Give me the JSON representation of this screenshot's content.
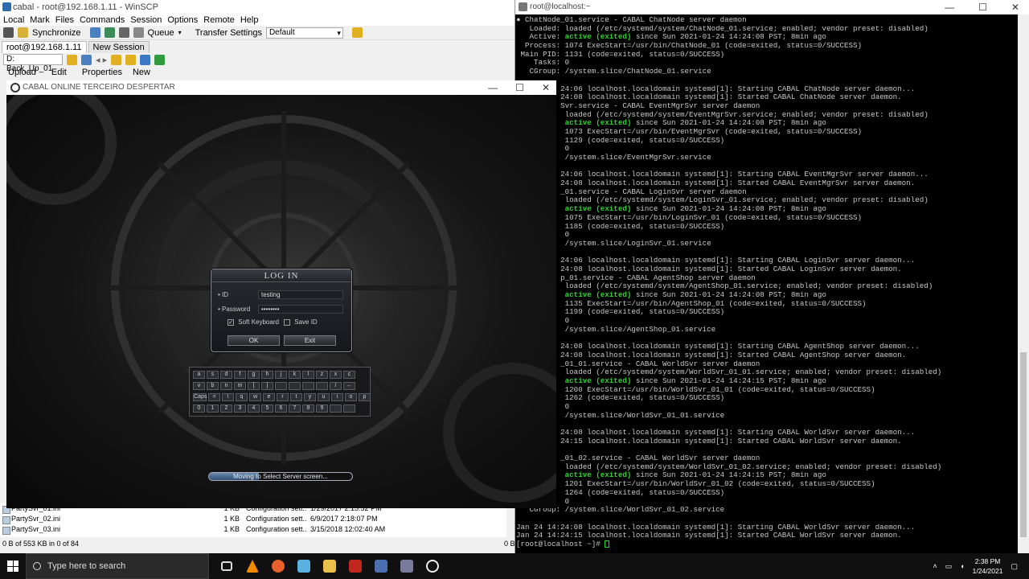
{
  "winscp": {
    "title": "cabal - root@192.168.1.11 - WinSCP",
    "menu": [
      "Local",
      "Mark",
      "Files",
      "Commands",
      "Session",
      "Options",
      "Remote",
      "Help"
    ],
    "toolbar": {
      "synchronize": "Synchronize",
      "queue": "Queue",
      "transfer_settings": "Transfer Settings",
      "transfer_value": "Default"
    },
    "tabs": [
      "root@192.168.1.11",
      "New Session"
    ],
    "drive": "D: Back_Up_01",
    "actions": {
      "upload": "Upload",
      "edit": "Edit",
      "properties": "Properties",
      "new": "New"
    },
    "files": [
      {
        "name": "PartySvr_01.ini",
        "size": "1 KB",
        "type": "Configuration sett...",
        "modified": "1/29/2017  2:15:52 PM"
      },
      {
        "name": "PartySvr_02.ini",
        "size": "1 KB",
        "type": "Configuration sett...",
        "modified": "6/9/2017  2:18:07 PM"
      },
      {
        "name": "PartySvr_03.ini",
        "size": "1 KB",
        "type": "Configuration sett...",
        "modified": "3/15/2018  12:02:40 AM"
      }
    ],
    "status": "0 B of 553 KB in 0 of 84",
    "status_right": "0 B"
  },
  "game": {
    "title": "CABAL ONLINE TERCEIRO DESPERTAR",
    "login": {
      "heading": "LOG IN",
      "id_label": "ID",
      "id_value": "testing",
      "password_label": "Password",
      "password_value": "••••••••",
      "soft_keyboard": "Soft Keyboard",
      "save_id": "Save ID",
      "ok": "OK",
      "exit": "Exit"
    },
    "keyboard_rows": [
      [
        "a",
        "s",
        "d",
        "f",
        "g",
        "h",
        "j",
        "k",
        "l",
        "z",
        "x",
        "c"
      ],
      [
        "v",
        "b",
        "n",
        "m",
        "[",
        "]",
        "",
        "",
        "",
        "",
        "/",
        "←"
      ],
      [
        "Caps",
        "=",
        "\\",
        "q",
        "w",
        "e",
        "r",
        "t",
        "y",
        "u",
        "i",
        "o",
        "p"
      ],
      [
        "0",
        "1",
        "2",
        "3",
        "4",
        "5",
        "6",
        "7",
        "8",
        "9",
        "",
        ""
      ]
    ],
    "progress_text": "Moving to Select Server screen...",
    "progress_fraction": 0.35
  },
  "putty": {
    "title": "root@localhost:~",
    "lines": [
      {
        "t": "● ChatNode_01.service - CABAL ChatNode server daemon"
      },
      {
        "t": "   Loaded: loaded (/etc/systemd/system/ChatNode_01.service; enabled; vendor preset: disabled)"
      },
      {
        "t": "   Active: ",
        "g": "active (exited)",
        "r": " since Sun 2021-01-24 14:24:08 PST; 8min ago"
      },
      {
        "t": "  Process: 1074 ExecStart=/usr/bin/ChatNode_01 (code=exited, status=0/SUCCESS)"
      },
      {
        "t": " Main PID: 1131 (code=exited, status=0/SUCCESS)"
      },
      {
        "t": "    Tasks: 0"
      },
      {
        "t": "   CGroup: /system.slice/ChatNode_01.service"
      },
      {
        "t": ""
      },
      {
        "t": "          24:06 localhost.localdomain systemd[1]: Starting CABAL ChatNode server daemon..."
      },
      {
        "t": "          24:08 localhost.localdomain systemd[1]: Started CABAL ChatNode server daemon."
      },
      {
        "t": "          Svr.service - CABAL EventMgrSvr server daemon"
      },
      {
        "t": "           loaded (/etc/systemd/system/EventMgrSvr.service; enabled; vendor preset: disabled)"
      },
      {
        "t": "           ",
        "g": "active (exited)",
        "r": " since Sun 2021-01-24 14:24:08 PST; 8min ago"
      },
      {
        "t": "           1073 ExecStart=/usr/bin/EventMgrSvr (code=exited, status=0/SUCCESS)"
      },
      {
        "t": "           1129 (code=exited, status=0/SUCCESS)"
      },
      {
        "t": "           0"
      },
      {
        "t": "           /system.slice/EventMgrSvr.service"
      },
      {
        "t": ""
      },
      {
        "t": "          24:06 localhost.localdomain systemd[1]: Starting CABAL EventMgrSvr server daemon..."
      },
      {
        "t": "          24:08 localhost.localdomain systemd[1]: Started CABAL EventMgrSvr server daemon."
      },
      {
        "t": "          _01.service - CABAL LoginSvr server daemon"
      },
      {
        "t": "           loaded (/etc/systemd/system/LoginSvr_01.service; enabled; vendor preset: disabled)"
      },
      {
        "t": "           ",
        "g": "active (exited)",
        "r": " since Sun 2021-01-24 14:24:08 PST; 8min ago"
      },
      {
        "t": "           1075 ExecStart=/usr/bin/LoginSvr_01 (code=exited, status=0/SUCCESS)"
      },
      {
        "t": "           1185 (code=exited, status=0/SUCCESS)"
      },
      {
        "t": "           0"
      },
      {
        "t": "           /system.slice/LoginSvr_01.service"
      },
      {
        "t": ""
      },
      {
        "t": "          24:06 localhost.localdomain systemd[1]: Starting CABAL LoginSvr server daemon..."
      },
      {
        "t": "          24:08 localhost.localdomain systemd[1]: Started CABAL LoginSvr server daemon."
      },
      {
        "t": "          p_01.service - CABAL AgentShop server daemon"
      },
      {
        "t": "           loaded (/etc/systemd/system/AgentShop_01.service; enabled; vendor preset: disabled)"
      },
      {
        "t": "           ",
        "g": "active (exited)",
        "r": " since Sun 2021-01-24 14:24:08 PST; 8min ago"
      },
      {
        "t": "           1135 ExecStart=/usr/bin/AgentShop_01 (code=exited, status=0/SUCCESS)"
      },
      {
        "t": "           1199 (code=exited, status=0/SUCCESS)"
      },
      {
        "t": "           0"
      },
      {
        "t": "           /system.slice/AgentShop_01.service"
      },
      {
        "t": ""
      },
      {
        "t": "          24:08 localhost.localdomain systemd[1]: Starting CABAL AgentShop server daemon..."
      },
      {
        "t": "          24:08 localhost.localdomain systemd[1]: Started CABAL AgentShop server daemon."
      },
      {
        "t": "          _01_01.service - CABAL WorldSvr server daemon"
      },
      {
        "t": "           loaded (/etc/systemd/system/WorldSvr_01_01.service; enabled; vendor preset: disabled)"
      },
      {
        "t": "           ",
        "g": "active (exited)",
        "r": " since Sun 2021-01-24 14:24:15 PST; 8min ago"
      },
      {
        "t": "           1200 ExecStart=/usr/bin/WorldSvr_01_01 (code=exited, status=0/SUCCESS)"
      },
      {
        "t": "           1262 (code=exited, status=0/SUCCESS)"
      },
      {
        "t": "           0"
      },
      {
        "t": "           /system.slice/WorldSvr_01_01.service"
      },
      {
        "t": ""
      },
      {
        "t": "          24:08 localhost.localdomain systemd[1]: Starting CABAL WorldSvr server daemon..."
      },
      {
        "t": "          24:15 localhost.localdomain systemd[1]: Started CABAL WorldSvr server daemon."
      },
      {
        "t": ""
      },
      {
        "t": "          _01_02.service - CABAL WorldSvr server daemon"
      },
      {
        "t": "           loaded (/etc/systemd/system/WorldSvr_01_02.service; enabled; vendor preset: disabled)"
      },
      {
        "t": "           ",
        "g": "active (exited)",
        "r": " since Sun 2021-01-24 14:24:15 PST; 8min ago"
      },
      {
        "t": "           1201 ExecStart=/usr/bin/WorldSvr_01_02 (code=exited, status=0/SUCCESS)"
      },
      {
        "t": "           1264 (code=exited, status=0/SUCCESS)"
      },
      {
        "t": "           0"
      },
      {
        "t": "   CGroup: /system.slice/WorldSvr_01_02.service"
      },
      {
        "t": ""
      },
      {
        "t": "Jan 24 14:24:08 localhost.localdomain systemd[1]: Starting CABAL WorldSvr server daemon..."
      },
      {
        "t": "Jan 24 14:24:15 localhost.localdomain systemd[1]: Started CABAL WorldSvr server daemon."
      },
      {
        "t": "[root@localhost ~]# "
      }
    ]
  },
  "taskbar": {
    "search_placeholder": "Type here to search",
    "time": "2:38 PM",
    "date": "1/24/2021"
  },
  "colors": {
    "terminal_green": "#2fd12f",
    "taskbar_bg": "#101010"
  }
}
